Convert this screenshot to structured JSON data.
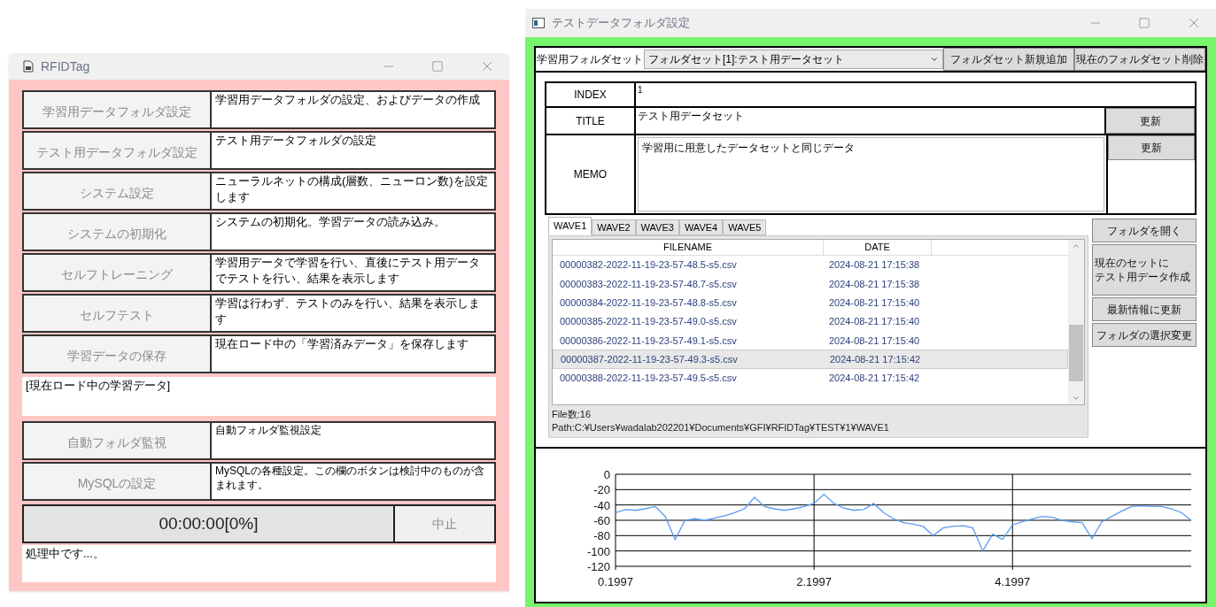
{
  "left_window": {
    "title": "RFIDTag",
    "rows": [
      {
        "button": "学習用データフォルダ設定",
        "description": "学習用データフォルダの設定、およびデータの作成"
      },
      {
        "button": "テスト用データフォルダ設定",
        "description": "テスト用データフォルダの設定"
      },
      {
        "button": "システム設定",
        "description": "ニューラルネットの構成(層数、ニューロン数)を設定します"
      },
      {
        "button": "システムの初期化",
        "description": "システムの初期化。学習データの読み込み。"
      },
      {
        "button": "セルフトレーニング",
        "description": "学習用データで学習を行い、直後にテスト用データでテストを行い、結果を表示します"
      },
      {
        "button": "セルフテスト",
        "description": "学習は行わず、テストのみを行い、結果を表示します"
      },
      {
        "button": "学習データの保存",
        "description": "現在ロード中の「学習済みデータ」を保存します"
      }
    ],
    "loaded_data": "[現在ロード中の学習データ]",
    "extra_rows": [
      {
        "button": "自動フォルダ監視",
        "description": "自動フォルダ監視設定"
      },
      {
        "button": "MySQLの設定",
        "description": "MySQLの各種設定。この欄のボタンは検討中のものが含まれます。"
      }
    ],
    "progress": "00:00:00[0%]",
    "cancel_button": "中止",
    "status": "処理中です...。"
  },
  "right_window": {
    "title": "テストデータフォルダ設定",
    "folder_set_label": "学習用フォルダセット",
    "folder_set_value": "フォルダセット[1]:テスト用データセット",
    "top_buttons": [
      "フォルダセット新規追加",
      "現在のフォルダセット削除"
    ],
    "index_label": "INDEX",
    "index_value": "1",
    "title_label": "TITLE",
    "title_value": "テスト用データセット",
    "title_update": "更新",
    "memo_label": "MEMO",
    "memo_value": "学習用に用意したデータセットと同じデータ",
    "memo_update": "更新",
    "tabs": [
      {
        "label": "WAVE1",
        "selected": true
      },
      {
        "label": "WAVE2",
        "selected": false
      },
      {
        "label": "WAVE3",
        "selected": false
      },
      {
        "label": "WAVE4",
        "selected": false
      },
      {
        "label": "WAVE5",
        "selected": false
      }
    ],
    "columns": [
      "FILENAME",
      "DATE"
    ],
    "files": [
      {
        "filename": "00000382-2022-11-19-23-57-48.5-s5.csv",
        "date": "2024-08-21 17:15:38",
        "selected": false
      },
      {
        "filename": "00000383-2022-11-19-23-57-48.7-s5.csv",
        "date": "2024-08-21 17:15:38",
        "selected": false
      },
      {
        "filename": "00000384-2022-11-19-23-57-48.8-s5.csv",
        "date": "2024-08-21 17:15:40",
        "selected": false
      },
      {
        "filename": "00000385-2022-11-19-23-57-49.0-s5.csv",
        "date": "2024-08-21 17:15:40",
        "selected": false
      },
      {
        "filename": "00000386-2022-11-19-23-57-49.1-s5.csv",
        "date": "2024-08-21 17:15:40",
        "selected": false
      },
      {
        "filename": "00000387-2022-11-19-23-57-49.3-s5.csv",
        "date": "2024-08-21 17:15:42",
        "selected": true
      },
      {
        "filename": "00000388-2022-11-19-23-57-49.5-s5.csv",
        "date": "2024-08-21 17:15:42",
        "selected": false
      }
    ],
    "file_count": "File数:16",
    "path": "Path:C:¥Users¥wadalab202201¥Documents¥GFI¥RFIDTag¥TEST¥1¥WAVE1",
    "side_buttons": [
      {
        "lines": [
          "フォルダを開く"
        ]
      },
      {
        "lines": [
          "現在のセットに",
          "テスト用データ作成"
        ]
      },
      {
        "lines": [
          "最新情報に更新"
        ]
      },
      {
        "lines": [
          "フォルダの選択変更"
        ]
      }
    ],
    "chart_data": {
      "type": "line",
      "grid": true,
      "xlim": [
        0.1997,
        6.0
      ],
      "ylim": [
        -120,
        0
      ],
      "xticks": [
        {
          "value": 0.1997,
          "label": "0.1997"
        },
        {
          "value": 2.1997,
          "label": "2.1997"
        },
        {
          "value": 4.1997,
          "label": "4.1997"
        }
      ],
      "yticks": [
        0,
        -20,
        -40,
        -60,
        -80,
        -100,
        -120
      ],
      "x": [
        0.2,
        0.3,
        0.4,
        0.5,
        0.6,
        0.7,
        0.8,
        0.9,
        1.0,
        1.1,
        1.2,
        1.3,
        1.4,
        1.5,
        1.6,
        1.7,
        1.8,
        1.9,
        2.0,
        2.1,
        2.2,
        2.3,
        2.4,
        2.5,
        2.6,
        2.7,
        2.8,
        2.9,
        3.0,
        3.1,
        3.2,
        3.3,
        3.4,
        3.5,
        3.6,
        3.7,
        3.8,
        3.9,
        4.0,
        4.1,
        4.2,
        4.3,
        4.4,
        4.5,
        4.6,
        4.7,
        4.8,
        4.9,
        5.0,
        5.1,
        5.2,
        5.3,
        5.4,
        5.5,
        5.6,
        5.7,
        5.8,
        5.9,
        6.0
      ],
      "series": [
        {
          "color": "#5b9bef",
          "values": [
            -50,
            -46,
            -47,
            -45,
            -42,
            -55,
            -85,
            -60,
            -58,
            -60,
            -57,
            -54,
            -50,
            -45,
            -30,
            -42,
            -45,
            -47,
            -45,
            -42,
            -38,
            -26,
            -38,
            -44,
            -47,
            -46,
            -38,
            -50,
            -58,
            -63,
            -65,
            -68,
            -80,
            -70,
            -68,
            -67,
            -70,
            -100,
            -78,
            -85,
            -66,
            -62,
            -58,
            -55,
            -56,
            -60,
            -62,
            -63,
            -84,
            -62,
            -55,
            -48,
            -42,
            -41,
            -42,
            -42,
            -45,
            -50,
            -60
          ]
        }
      ]
    }
  }
}
